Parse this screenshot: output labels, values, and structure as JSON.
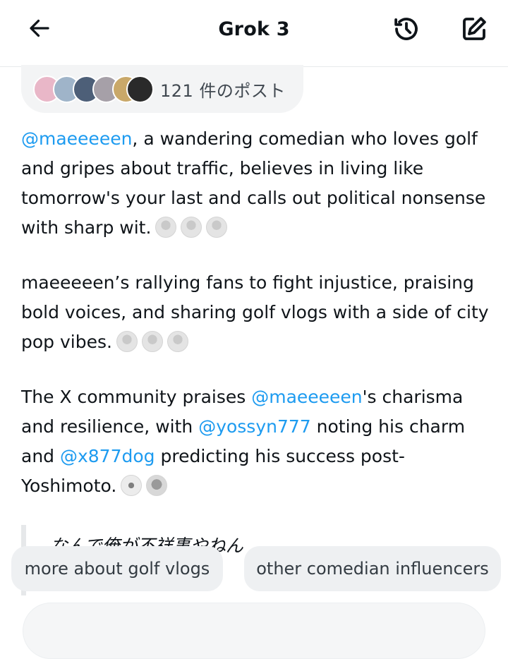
{
  "header": {
    "title": "Grok 3",
    "back_icon": "arrow-left-icon",
    "history_icon": "history-icon",
    "compose_icon": "compose-icon"
  },
  "sources": {
    "count_label": "121 件のポスト",
    "avatar_colors": [
      "#e9b7c8",
      "#9fb4c9",
      "#4d5f78",
      "#a6a0a8",
      "#c9a869",
      "#2a2a2a"
    ]
  },
  "messages": [
    {
      "mention": "@maeeeeen",
      "text": ", a wandering comedian who loves golf and gripes about traffic, believes in living like tomorrow's your last and calls out political nonsense with sharp wit."
    },
    {
      "text": "maeeeeen’s rallying fans to fight injustice, praising bold voices, and sharing golf vlogs with a side of city pop vibes."
    },
    {
      "text_a": "The X community praises ",
      "mention_a": "@maeeeeen",
      "text_b": "'s charisma and resilience, with ",
      "mention_b": "@yossyn777",
      "text_c": " noting his charm and ",
      "mention_c": "@x877dog",
      "text_d": " predicting his success post-Yoshimoto."
    }
  ],
  "quote": "なんで俺が不祥事やねん",
  "suggestions": [
    "more about golf vlogs",
    "other comedian influencers"
  ],
  "colors": {
    "accent": "#1d9bf0",
    "chip_bg": "#eef0f2"
  }
}
